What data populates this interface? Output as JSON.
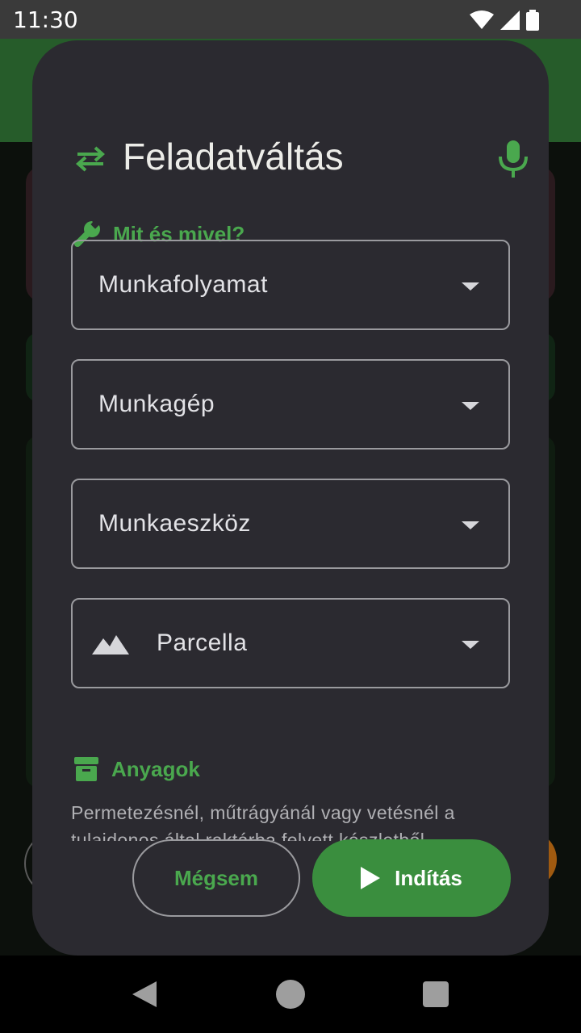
{
  "status_bar": {
    "time": "11:30"
  },
  "dialog": {
    "title": "Feladatváltás",
    "section_tools": "Mit és mivel?",
    "fields": {
      "workflow": "Munkafolyamat",
      "machine": "Munkagép",
      "tool": "Munkaeszköz",
      "parcel": "Parcella"
    },
    "section_materials": "Anyagok",
    "materials_text": "Permetezésnél, műtrágyánál vagy vetésnél a tulajdonos által raktárba felvett készletből",
    "buttons": {
      "cancel": "Mégsem",
      "start": "Indítás"
    }
  },
  "colors": {
    "accent": "#3a8e3e",
    "accent_text": "#4aa84e",
    "dialog_bg": "#2b2a30"
  },
  "icons": [
    "swap-icon",
    "mic-icon",
    "wrench-icon",
    "dropdown-arrow-icon",
    "mountain-icon",
    "archive-icon",
    "play-icon"
  ]
}
